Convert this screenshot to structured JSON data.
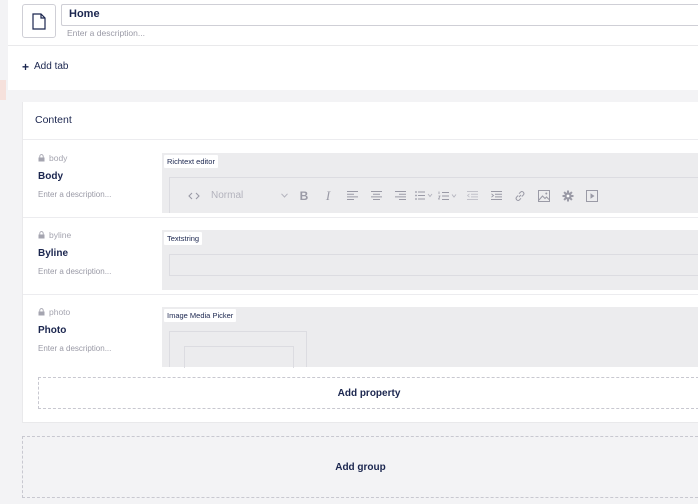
{
  "header": {
    "name_value": "Home",
    "description_placeholder": "Enter a description...",
    "icon": "document-icon"
  },
  "tabs": {
    "add_tab_label": "Add tab"
  },
  "group": {
    "title": "Content",
    "properties": [
      {
        "alias": "body",
        "label": "Body",
        "description_placeholder": "Enter a description...",
        "editor": "Richtext editor",
        "format_value": "Normal"
      },
      {
        "alias": "byline",
        "label": "Byline",
        "description_placeholder": "Enter a description...",
        "editor": "Textstring"
      },
      {
        "alias": "photo",
        "label": "Photo",
        "description_placeholder": "Enter a description...",
        "editor": "Image Media Picker"
      }
    ],
    "add_property_label": "Add property"
  },
  "add_group_label": "Add group",
  "colors": {
    "text": "#1b264f",
    "muted": "#9a9aa6",
    "background": "#f3f3f5",
    "preview": "#ececee"
  }
}
